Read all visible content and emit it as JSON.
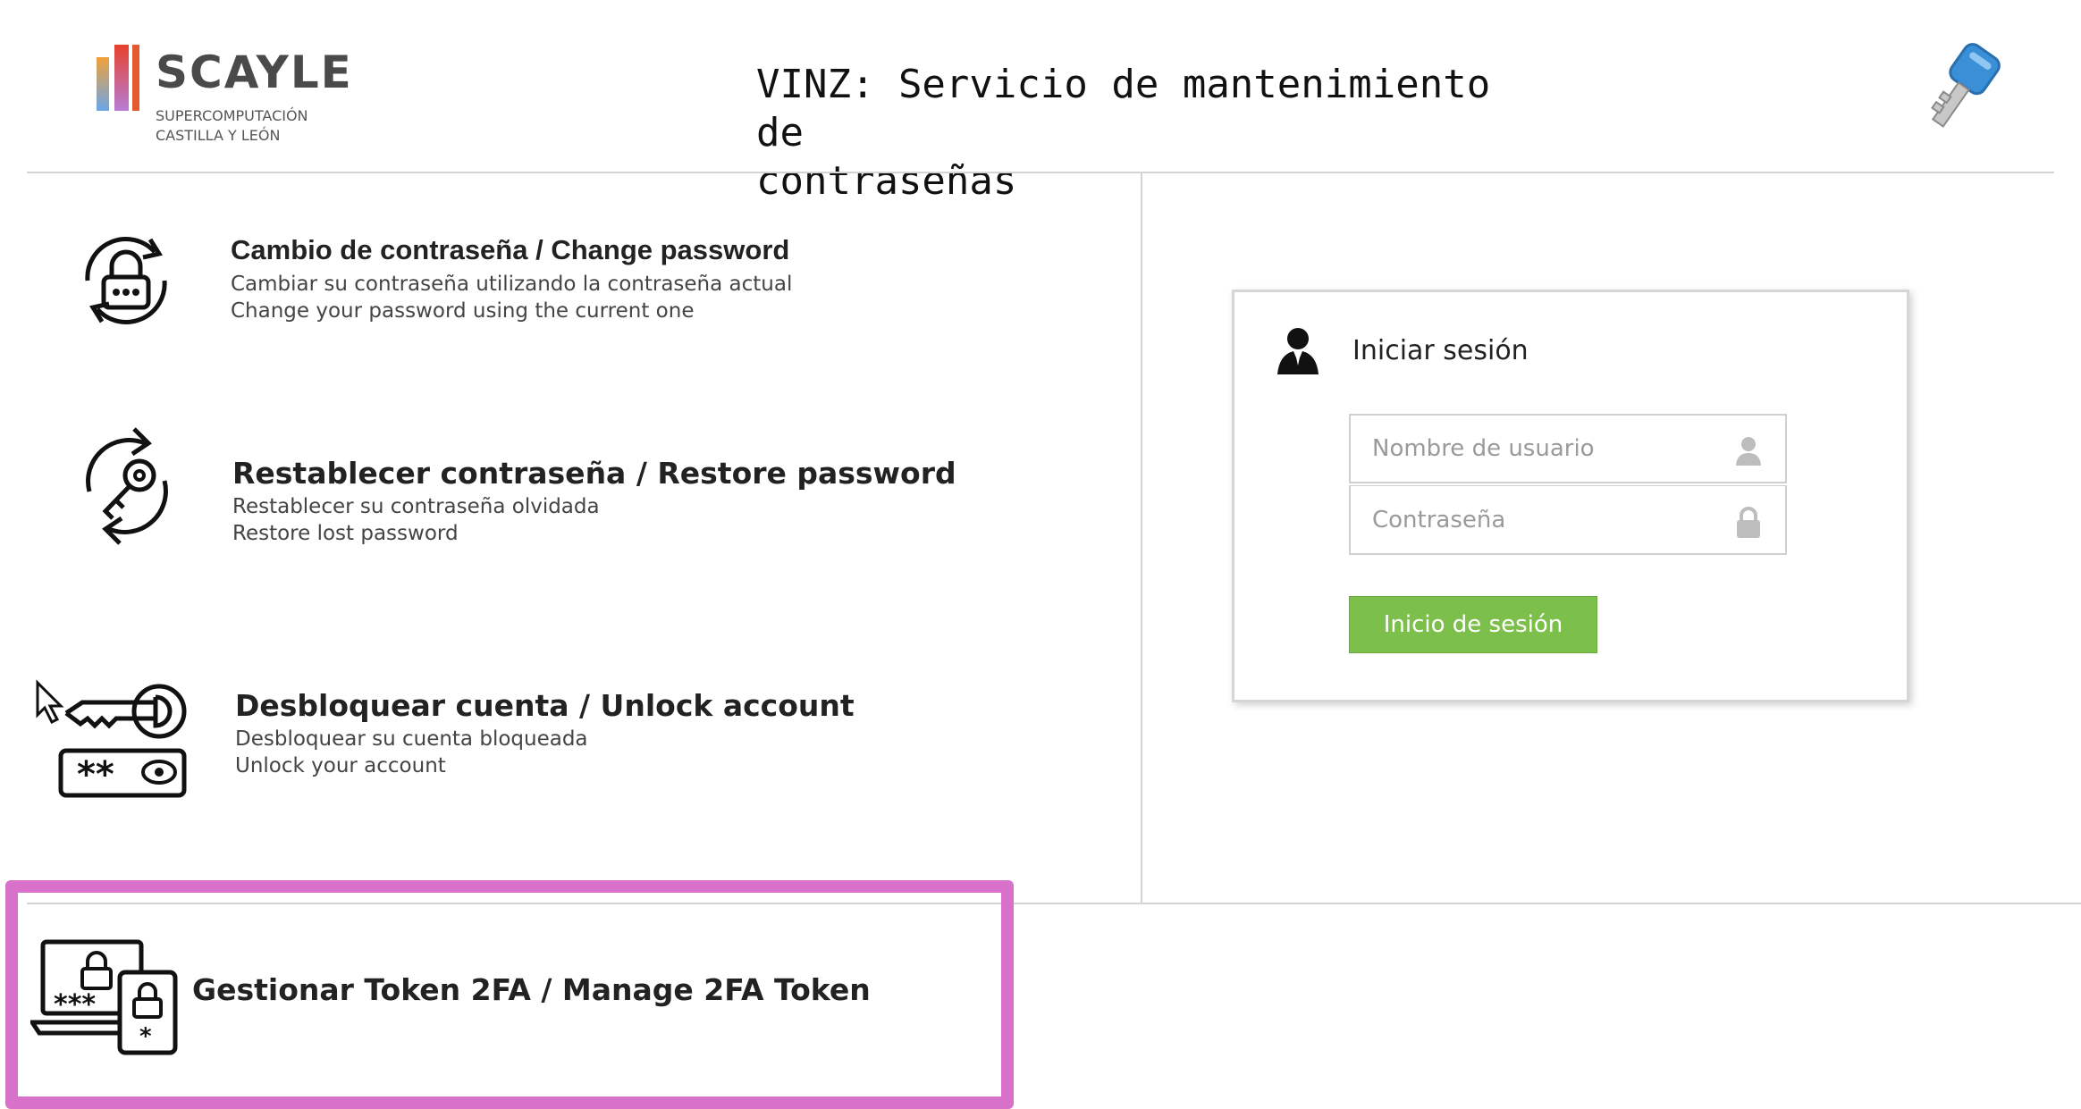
{
  "header": {
    "logo_brand": "SCAYLE",
    "logo_sub1": "SUPERCOMPUTACIÓN",
    "logo_sub2": "CASTILLA Y LEÓN",
    "title_line1": "VINZ: Servicio de mantenimiento de",
    "title_line2": "contraseñas",
    "key_icon": "key-icon"
  },
  "menu": {
    "items": [
      {
        "title": "Cambio de contraseña / Change password",
        "desc_es": "Cambiar su contraseña utilizando la contraseña actual",
        "desc_en": "Change your password using the current one",
        "icon": "lock-refresh-icon"
      },
      {
        "title": "Restablecer contraseña / Restore password",
        "desc_es": "Restablecer su contraseña olvidada",
        "desc_en": "Restore lost password",
        "icon": "key-refresh-icon"
      },
      {
        "title": "Desbloquear cuenta / Unlock account",
        "desc_es": "Desbloquear su cuenta bloqueada",
        "desc_en": "Unlock your account",
        "icon": "key-password-icon"
      },
      {
        "title": "Gestionar Token 2FA / Manage 2FA Token",
        "icon": "laptop-phone-lock-icon"
      }
    ]
  },
  "login": {
    "title": "Iniciar sesión",
    "username_placeholder": "Nombre de usuario",
    "password_placeholder": "Contraseña",
    "submit_label": "Inicio de sesión",
    "button_color": "#7cc04b"
  },
  "highlight_color": "#d771c9"
}
